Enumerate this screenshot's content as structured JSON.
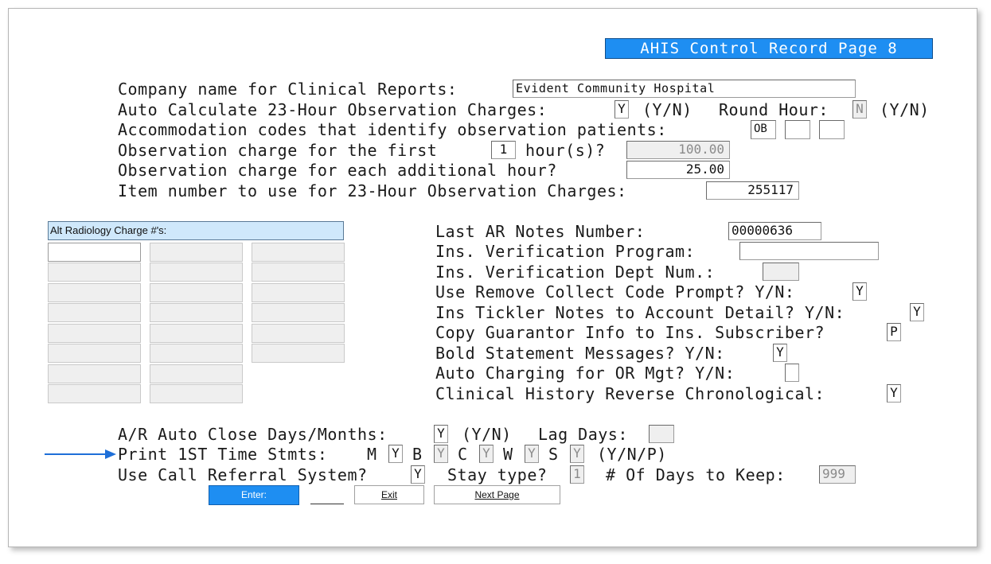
{
  "page_title": "AHIS Control Record Page 8",
  "top_section": {
    "company_label": "Company name for Clinical Reports:",
    "company_value": "Evident Community Hospital",
    "auto_calc_label": "Auto Calculate 23-Hour Observation Charges:",
    "auto_calc_value": "Y",
    "yn_hint": "(Y/N)",
    "round_hour_label": "Round Hour:",
    "round_hour_value": "N",
    "accom_label": "Accommodation codes that identify observation patients:",
    "accom_codes": [
      "OB",
      "",
      ""
    ],
    "first_charge_label": "Observation charge for the first",
    "first_hours_value": "1",
    "first_hours_suffix": "hour(s)?",
    "first_charge_value": "100.00",
    "additional_label": "Observation charge for each additional hour?",
    "additional_value": "25.00",
    "item_label": "Item number to use for 23-Hour Observation Charges:",
    "item_value": "255117"
  },
  "radiology_grid": {
    "header": "Alt Radiology Charge #'s:"
  },
  "right_section": {
    "last_ar_label": "Last AR Notes Number:",
    "last_ar_value": "00000636",
    "ins_ver_prog_label": "Ins. Verification Program:",
    "ins_ver_prog_value": "",
    "ins_ver_dept_label": "Ins. Verification Dept Num.:",
    "ins_ver_dept_value": "",
    "remove_collect_label": "Use Remove Collect Code Prompt? Y/N:",
    "remove_collect_value": "Y",
    "tickler_label": "Ins Tickler Notes to Account Detail? Y/N:",
    "tickler_value": "Y",
    "copy_guarantor_label": "Copy Guarantor Info to Ins. Subscriber?",
    "copy_guarantor_value": "P",
    "bold_stmt_label": "Bold Statement Messages? Y/N:",
    "bold_stmt_value": "Y",
    "auto_charging_label": "Auto Charging for OR Mgt? Y/N:",
    "auto_charging_value": "",
    "clinical_history_label": "Clinical History Reverse Chronological:",
    "clinical_history_value": "Y"
  },
  "bottom_section": {
    "ar_close_label": "A/R Auto Close Days/Months:",
    "ar_close_value": "Y",
    "yn_hint": "(Y/N)",
    "lag_days_label": "Lag Days:",
    "lag_days_value": "",
    "print_label": "Print 1ST Time Stmts:",
    "print_m_label": "M",
    "print_m_value": "Y",
    "print_b_label": "B",
    "print_b_value": "Y",
    "print_c_label": "C",
    "print_c_value": "Y",
    "print_w_label": "W",
    "print_w_value": "Y",
    "print_s_label": "S",
    "print_s_value": "Y",
    "ynp_hint": "(Y/N/P)",
    "referral_label": "Use Call Referral System?",
    "referral_value": "Y",
    "stay_type_label": "Stay type?",
    "stay_type_value": "1",
    "days_keep_label": "# Of Days to Keep:",
    "days_keep_value": "999"
  },
  "buttons": {
    "enter": "Enter:",
    "exit": "Exit",
    "next_page": "Next Page"
  },
  "colors": {
    "accent": "#1e8ef2",
    "grid_header_bg": "#cfe8fb",
    "disabled_bg": "#efefef"
  }
}
